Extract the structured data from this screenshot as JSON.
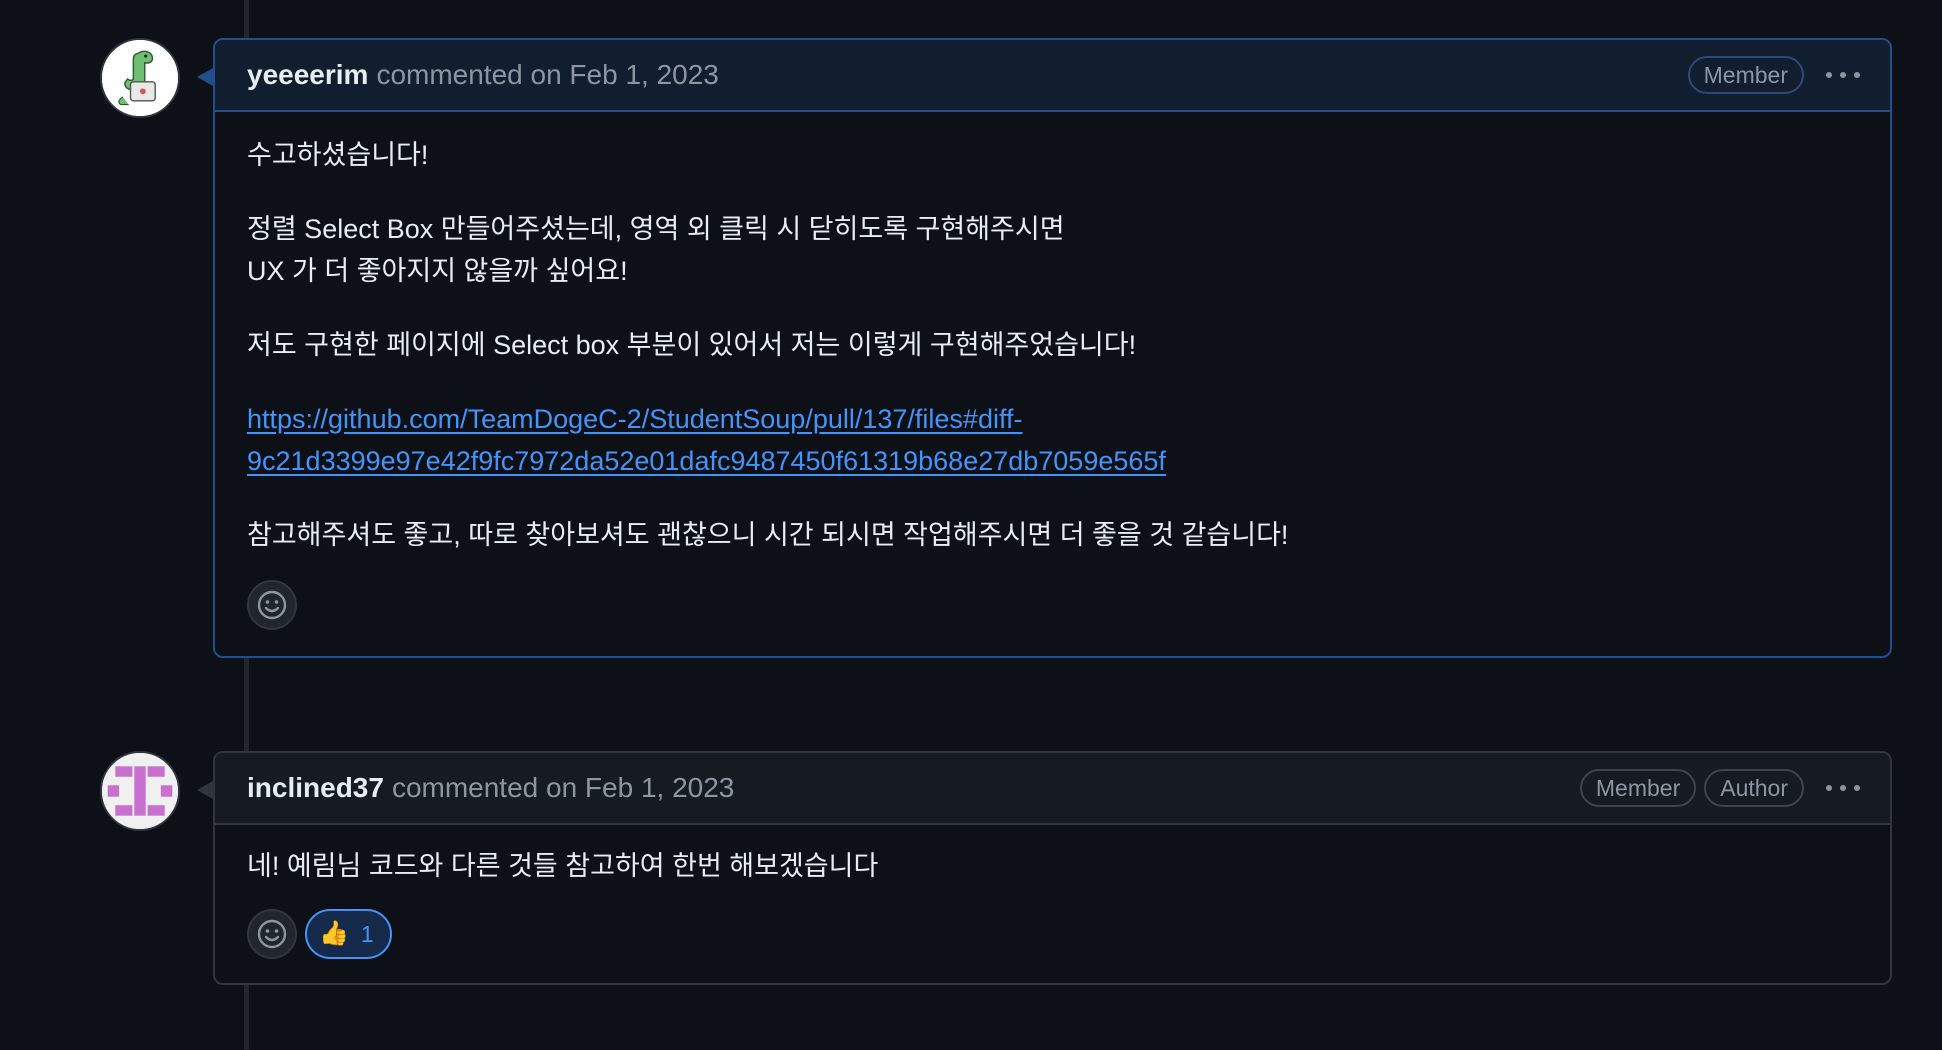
{
  "comments": [
    {
      "author": "yeeeerim",
      "meta": "commented on Feb 1, 2023",
      "badges": [
        "Member"
      ],
      "paragraphs": [
        "수고하셨습니다!",
        "정렬 Select Box 만들어주셨는데, 영역 외 클릭 시 닫히도록 구현해주시면",
        "UX 가 더 좋아지지 않을까 싶어요!",
        "저도 구현한 페이지에 Select box 부분이 있어서 저는 이렇게 구현해주었습니다!",
        "참고해주셔도 좋고, 따로 찾아보셔도 괜찮으니 시간 되시면 작업해주시면 더 좋을 것 같습니다!"
      ],
      "link": {
        "line1": "https://github.com/TeamDogeC-2/StudentSoup/pull/137/files#diff-",
        "line2": "9c21d3399e97e42f9fc7972da52e01dafc9487450f61319b68e27db7059e565f"
      },
      "icons": {
        "avatar": "dinosaur-avatar",
        "react": "smiley-icon",
        "more": "kebab-icon"
      }
    },
    {
      "author": "inclined37",
      "meta": "commented on Feb 1, 2023",
      "badges": [
        "Member",
        "Author"
      ],
      "paragraphs": [
        "네! 예림님 코드와 다른 것들 참고하여 한번 해보겠습니다"
      ],
      "reaction": {
        "emoji": "👍",
        "count": "1"
      },
      "icons": {
        "avatar": "identicon-avatar",
        "react": "smiley-icon",
        "more": "kebab-icon"
      }
    }
  ],
  "colors": {
    "background": "#0d1117",
    "link": "#4493f8",
    "highlight_border": "#1f4f8c",
    "identicon": "#c86fd0"
  }
}
